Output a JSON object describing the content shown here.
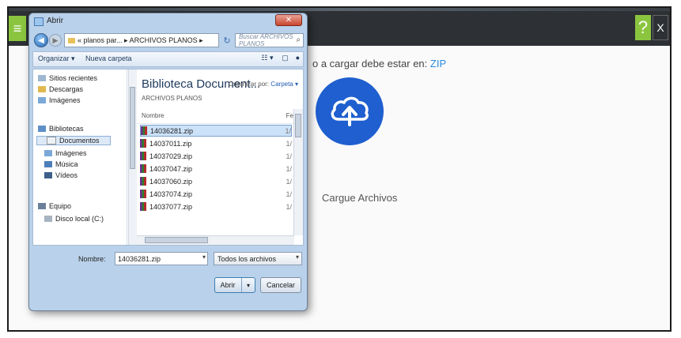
{
  "app": {
    "menu_icon": "hamburger-icon",
    "help_label": "?",
    "close_label": "X",
    "instruction_text": "o a cargar debe estar en:",
    "instruction_highlight": "ZIP",
    "upload_icon": "cloud-upload-icon",
    "upload_label": "Cargue Archivos",
    "accent_color": "#8bc53f",
    "upload_color": "#1f5fcf"
  },
  "dialog": {
    "title": "Abrir",
    "close_label": "✕",
    "address": {
      "path": "« planos par... ▸ ARCHIVOS PLANOS ▸",
      "search_placeholder": "Buscar ARCHIVOS PLANOS"
    },
    "toolbar": {
      "organize_label": "Organizar ▾",
      "new_folder_label": "Nueva carpeta"
    },
    "nav": [
      {
        "label": "Sitios recientes",
        "icon": "recent-places-icon"
      },
      {
        "label": "Descargas",
        "icon": "downloads-folder-icon"
      },
      {
        "label": "Imágenes",
        "icon": "pictures-folder-icon"
      },
      {
        "label": "Bibliotecas",
        "icon": "libraries-icon"
      },
      {
        "label": "Documentos",
        "icon": "documents-library-icon"
      },
      {
        "label": "Imágenes",
        "icon": "pictures-library-icon"
      },
      {
        "label": "Música",
        "icon": "music-library-icon"
      },
      {
        "label": "Vídeos",
        "icon": "videos-library-icon"
      },
      {
        "label": "Equipo",
        "icon": "computer-icon"
      },
      {
        "label": "Disco local (C:)",
        "icon": "local-disk-icon"
      }
    ],
    "library": {
      "title": "Biblioteca Document...",
      "subtitle": "ARCHIVOS PLANOS",
      "arrange_label": "Organizar por:",
      "arrange_value": "Carpeta ▾",
      "col_name": "Nombre",
      "col_right": "Fe"
    },
    "files": [
      {
        "name": "14036281.zip",
        "selected": true
      },
      {
        "name": "14037011.zip",
        "selected": false
      },
      {
        "name": "14037029.zip",
        "selected": false
      },
      {
        "name": "14037047.zip",
        "selected": false
      },
      {
        "name": "14037060.zip",
        "selected": false
      },
      {
        "name": "14037074.zip",
        "selected": false
      },
      {
        "name": "14037077.zip",
        "selected": false
      }
    ],
    "file_name_label": "Nombre:",
    "file_name_value": "14036281.zip",
    "file_type_value": "Todos los archivos",
    "open_label": "Abrir",
    "cancel_label": "Cancelar"
  }
}
